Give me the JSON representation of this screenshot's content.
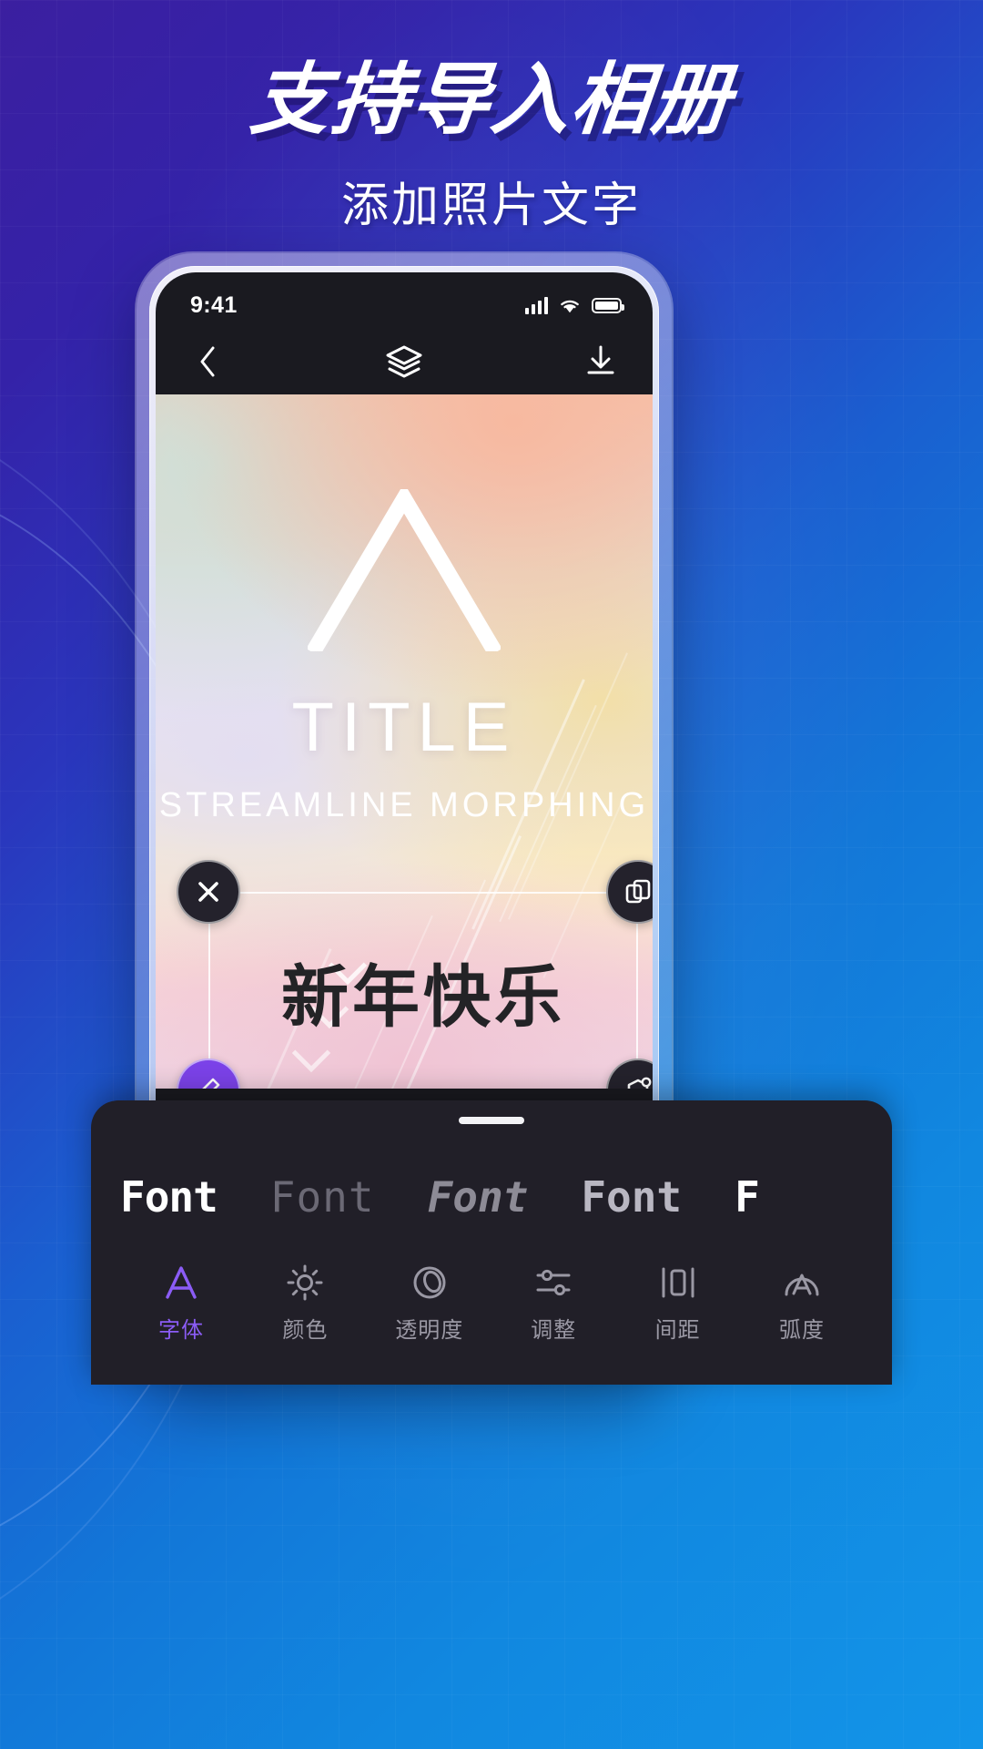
{
  "promo": {
    "title": "支持导入相册",
    "subtitle": "添加照片文字"
  },
  "colors": {
    "accent_purple": "#8b5cf6",
    "handle_purple": "#7b42e8",
    "sheet_bg": "#211f28",
    "bg_start": "#3b1fa0",
    "bg_end": "#1294e8"
  },
  "phone": {
    "statusbar": {
      "time": "9:41",
      "signal_icon": "signal-bars-icon",
      "wifi_icon": "wifi-icon",
      "battery_icon": "battery-icon"
    },
    "navbar": {
      "back_icon": "chevron-left-icon",
      "layers_icon": "layers-icon",
      "download_icon": "download-icon"
    },
    "canvas": {
      "art_title": "TITLE",
      "art_subtitle": "STREAMLINE MORPHING",
      "mark_icon": "chevron-up-mark-icon",
      "selection": {
        "text": "新年快乐",
        "handles": [
          {
            "name": "delete-handle",
            "icon": "close-icon",
            "style": "dark"
          },
          {
            "name": "duplicate-handle",
            "icon": "copy-icon",
            "style": "dark"
          },
          {
            "name": "edit-handle",
            "icon": "pen-edit-icon",
            "style": "purple"
          },
          {
            "name": "transform-handle",
            "icon": "rotate-shape-icon",
            "style": "dark"
          }
        ]
      }
    },
    "sheet": {
      "grabber_icon": "drag-grabber-icon",
      "font_samples": [
        {
          "label": "Font",
          "selected": true
        },
        {
          "label": "Font",
          "selected": false
        },
        {
          "label": "Font",
          "selected": false
        },
        {
          "label": "Font",
          "selected": false
        },
        {
          "label": "F",
          "selected": false
        }
      ],
      "tabs": [
        {
          "label": "字体",
          "icon": "letter-a-icon",
          "active": true
        },
        {
          "label": "颜色",
          "icon": "brightness-icon",
          "active": false
        },
        {
          "label": "透明度",
          "icon": "opacity-circle-icon",
          "active": false
        },
        {
          "label": "调整",
          "icon": "sliders-icon",
          "active": false
        },
        {
          "label": "间距",
          "icon": "spacing-icon",
          "active": false
        },
        {
          "label": "弧度",
          "icon": "arc-a-icon",
          "active": false
        }
      ]
    }
  }
}
